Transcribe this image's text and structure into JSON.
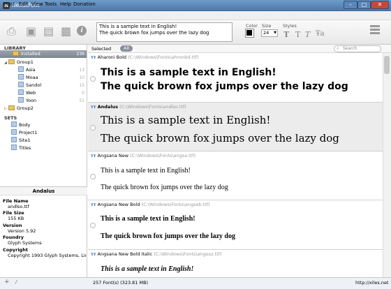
{
  "window": {
    "title": "NexusFont"
  },
  "menu": [
    "Font",
    "Edit",
    "View",
    "Tools",
    "Help",
    "Donation"
  ],
  "toolbar": {
    "sample_text_line1": "This is a sample text in English!",
    "sample_text_line2": "The quick brown fox jumps over the lazy dog",
    "color_label": "Color",
    "size_label": "Size",
    "size_value": "24",
    "styles_label": "Styles"
  },
  "library": {
    "header": "LIBRARY",
    "items": [
      {
        "label": "Installed",
        "count": "236"
      },
      {
        "label": "Group1",
        "count": ""
      },
      {
        "label": "Asia",
        "count": "13"
      },
      {
        "label": "Moaa",
        "count": "10"
      },
      {
        "label": "Sandol",
        "count": "15"
      },
      {
        "label": "Web",
        "count": "0"
      },
      {
        "label": "Yoon",
        "count": "51"
      },
      {
        "label": "Group2",
        "count": ""
      }
    ]
  },
  "sets": {
    "header": "SETS",
    "items": [
      "Body",
      "Project1",
      "Site1",
      "Titles"
    ]
  },
  "info": {
    "title": "Andalus",
    "fields": [
      {
        "key": "File Name",
        "value": "andlso.ttf"
      },
      {
        "key": "File Size",
        "value": "155 KB"
      },
      {
        "key": "Version",
        "value": "Version 5.92"
      },
      {
        "key": "Foundry",
        "value": "Glyph Systems"
      },
      {
        "key": "Copyright",
        "value": "Copyright 1993 Glyph Systems, Limit..."
      }
    ]
  },
  "list_header": {
    "selected": "Selected",
    "all": "All",
    "search_placeholder": "Search"
  },
  "fonts": [
    {
      "name": "Aharoni Bold",
      "path": "(C:\\Windows\\Fonts\\ahronbd.ttf)",
      "line1": "This is a sample text in English!",
      "line2": "The quick brown fox jumps over the lazy dog"
    },
    {
      "name": "Andalus",
      "path": "(C:\\Windows\\Fonts\\andlso.ttf)",
      "line1": "This is a sample text in English!",
      "line2": "The quick brown fox jumps over the lazy dog"
    },
    {
      "name": "Angsana New",
      "path": "(C:\\Windows\\Fonts\\angsa.ttf)",
      "line1": "This is a sample text in English!",
      "line2": "The quick brown fox jumps over the lazy dog"
    },
    {
      "name": "Angsana New Bold",
      "path": "(C:\\Windows\\Fonts\\angsab.ttf)",
      "line1": "This is a sample text in English!",
      "line2": "The quick brown fox jumps over the lazy dog"
    },
    {
      "name": "Angsana New Bold Italic",
      "path": "(C:\\Windows\\Fonts\\angsaz.ttf)",
      "line1": "This is a sample text in English!",
      "line2": ""
    }
  ],
  "status": {
    "count": "257 Font(s) (323.81 MB)",
    "url": "http://xiles.net"
  }
}
